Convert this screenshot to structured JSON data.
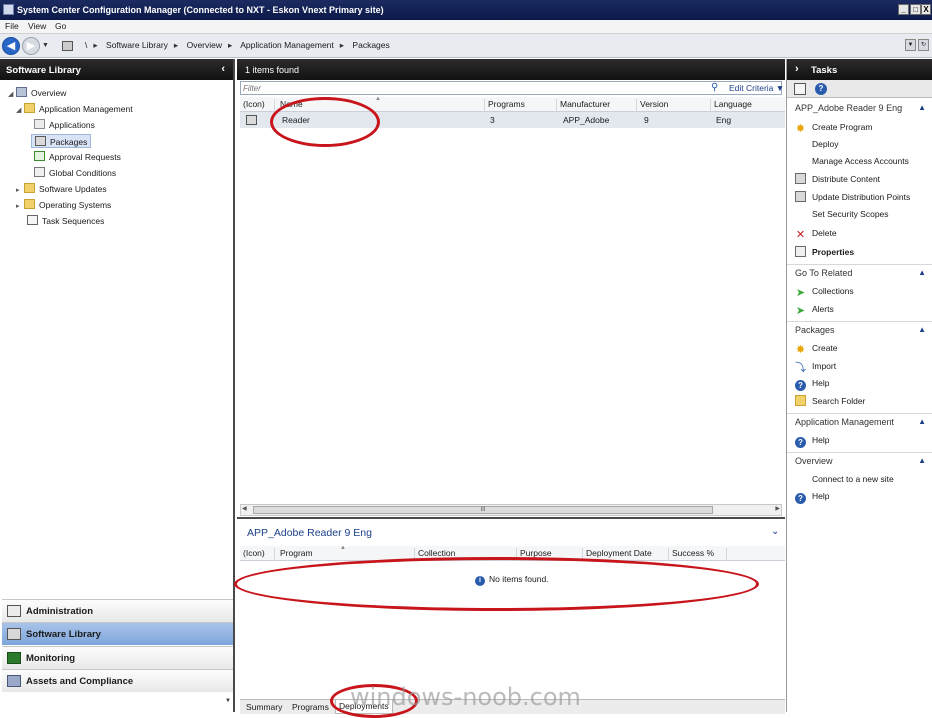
{
  "window": {
    "title": "System Center Configuration Manager (Connected to NXT - Eskon Vnext Primary site)",
    "buttons": [
      "_",
      "□",
      "X"
    ]
  },
  "menu": [
    "File",
    "View",
    "Go"
  ],
  "address": {
    "root": "\\",
    "crumbs": [
      "Software Library",
      "Overview",
      "Application Management",
      "Packages"
    ]
  },
  "left": {
    "header": "Software Library",
    "tree": {
      "overview": "Overview",
      "app_mgmt": "Application Management",
      "applications": "Applications",
      "packages": "Packages",
      "approval": "Approval Requests",
      "global": "Global Conditions",
      "updates": "Software Updates",
      "os": "Operating Systems",
      "tasks": "Task Sequences"
    },
    "splitter": "........",
    "workspaces": [
      "Administration",
      "Software Library",
      "Monitoring",
      "Assets and Compliance"
    ]
  },
  "list": {
    "header": "1 items found",
    "filter_placeholder": "Filter",
    "edit_criteria": "Edit Criteria",
    "columns": [
      "(Icon)",
      "Name",
      "Programs",
      "Manufacturer",
      "Version",
      "Language"
    ],
    "row": {
      "name": "Reader",
      "programs": "3",
      "manufacturer": "APP_Adobe",
      "version": "9",
      "language": "Eng"
    },
    "scroll_grip": "III"
  },
  "detail": {
    "title": "APP_Adobe Reader 9 Eng",
    "columns": [
      "(Icon)",
      "Program",
      "Collection",
      "Purpose",
      "Deployment Date",
      "Success %"
    ],
    "empty": "No items found.",
    "tabs": [
      "Summary",
      "Programs",
      "Deployments"
    ]
  },
  "tasks": {
    "header": "Tasks",
    "sections": {
      "item": {
        "title": "APP_Adobe Reader 9 Eng",
        "items": [
          "Create Program",
          "Deploy",
          "Manage Access Accounts",
          "Distribute Content",
          "Update Distribution Points",
          "Set Security Scopes",
          "Delete",
          "Properties"
        ]
      },
      "related": {
        "title": "Go To Related",
        "items": [
          "Collections",
          "Alerts"
        ]
      },
      "packages": {
        "title": "Packages",
        "items": [
          "Create",
          "Import",
          "Help",
          "Search Folder"
        ]
      },
      "appmgmt": {
        "title": "Application Management",
        "items": [
          "Help"
        ]
      },
      "overview": {
        "title": "Overview",
        "items": [
          "Connect to a new site",
          "Help"
        ]
      }
    }
  },
  "watermark": "windows-noob.com",
  "colors": {
    "annotation": "#c8151b",
    "accent": "#1c3f8a",
    "selected_workspace": "#7ea6dc"
  }
}
